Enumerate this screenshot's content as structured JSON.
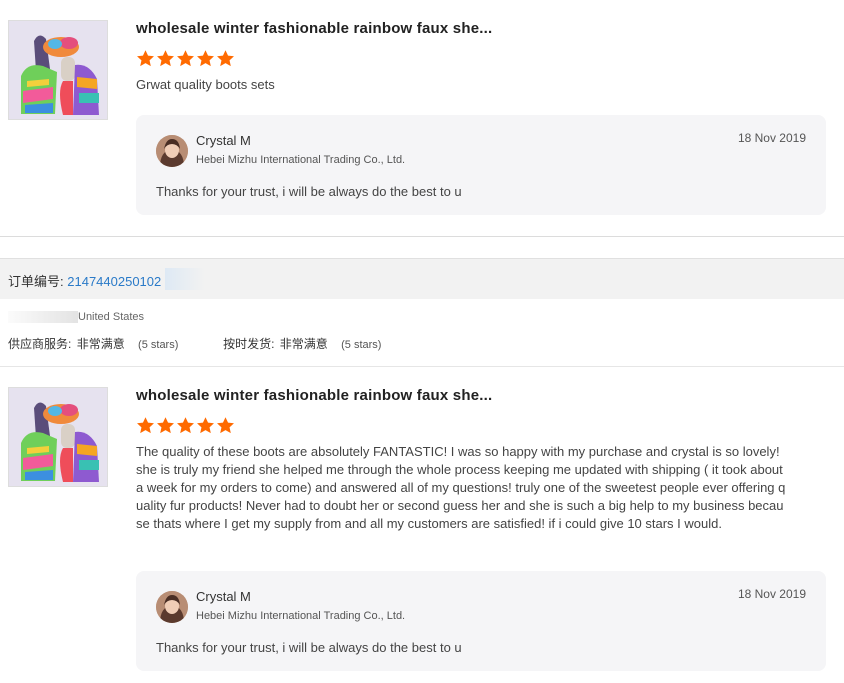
{
  "reviews": [
    {
      "product_title": "wholesale winter fashionable rainbow faux she...",
      "rating": 5,
      "comment": "Grwat quality boots sets",
      "reply": {
        "seller_name": "Crystal M",
        "company": "Hebei Mizhu International Trading Co., Ltd.",
        "date": "18 Nov 2019",
        "text": "Thanks for your trust, i will be always do the best  to u"
      }
    },
    {
      "product_title": "wholesale winter fashionable rainbow faux she...",
      "rating": 5,
      "comment": "The quality of these boots are absolutely FANTASTIC! I was so happy with my purchase and crystal is so lovely! she is truly my friend she helped me through the whole process keeping me updated with shipping ( it took about a week for my orders to come) and answered all of my questions! truly one of the sweetest people ever offering quality fur products! Never had to doubt her or second guess her and she is such a big help to my business because thats where I get my supply from and all my customers are satisfied! if i could give 10 stars I would.",
      "reply": {
        "seller_name": "Crystal M",
        "company": "Hebei Mizhu International Trading Co., Ltd.",
        "date": "18 Nov 2019",
        "text": "Thanks for your trust, i will be always do the best  to u"
      }
    }
  ],
  "order": {
    "label": "订单编号:",
    "number": "2147440250102"
  },
  "buyer": {
    "country": "United States"
  },
  "service_ratings": {
    "supplier_service_label": "供应商服务:",
    "supplier_service_value": "非常满意",
    "supplier_service_stars": "(5 stars)",
    "ontime_shipping_label": "按时发货:",
    "ontime_shipping_value": "非常满意",
    "ontime_shipping_stars": "(5 stars)"
  },
  "colors": {
    "star": "#ff6a00",
    "order_number": "#2a7ac8",
    "reply_background": "#f5f5f7"
  }
}
